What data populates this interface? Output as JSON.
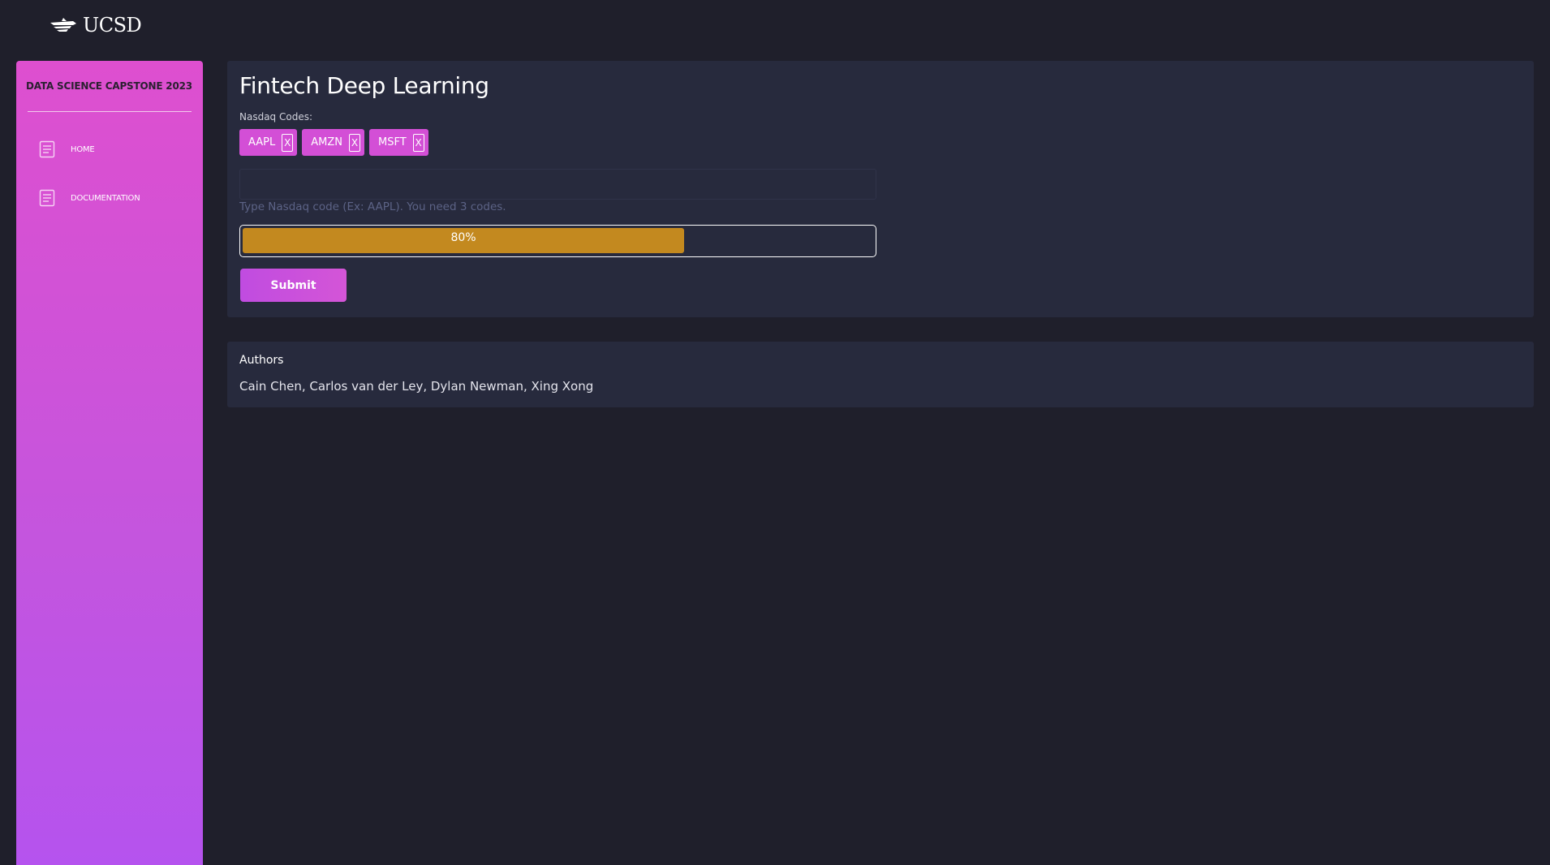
{
  "header": {
    "logo_text": "UCSD"
  },
  "sidebar": {
    "title": "DATA SCIENCE CAPSTONE 2023",
    "items": [
      {
        "label": "HOME",
        "icon": "document-icon"
      },
      {
        "label": "DOCUMENTATION",
        "icon": "document-icon"
      }
    ]
  },
  "main": {
    "title": "Fintech Deep Learning",
    "codes_label": "Nasdaq Codes:",
    "chips": [
      {
        "label": "AAPL",
        "remove": "X"
      },
      {
        "label": "AMZN",
        "remove": "X"
      },
      {
        "label": "MSFT",
        "remove": "X"
      }
    ],
    "input": {
      "value": "",
      "placeholder": ""
    },
    "helper_text": "Type Nasdaq code (Ex: AAPL). You need 3 codes.",
    "progress": {
      "value": 0.7,
      "label": "80%"
    },
    "submit_label": "Submit"
  },
  "authors": {
    "heading": "Authors",
    "names": "Cain Chen, Carlos van der Ley, Dylan Newman, Xing Xong"
  },
  "colors": {
    "background": "#1f1f2b",
    "card": "#272a3d",
    "sidebar_top": "#de4fcf",
    "sidebar_bottom": "#b553ee",
    "chip": "#d34fd6",
    "progress_fill": "#c3891f",
    "helper_text": "#5c6386"
  }
}
